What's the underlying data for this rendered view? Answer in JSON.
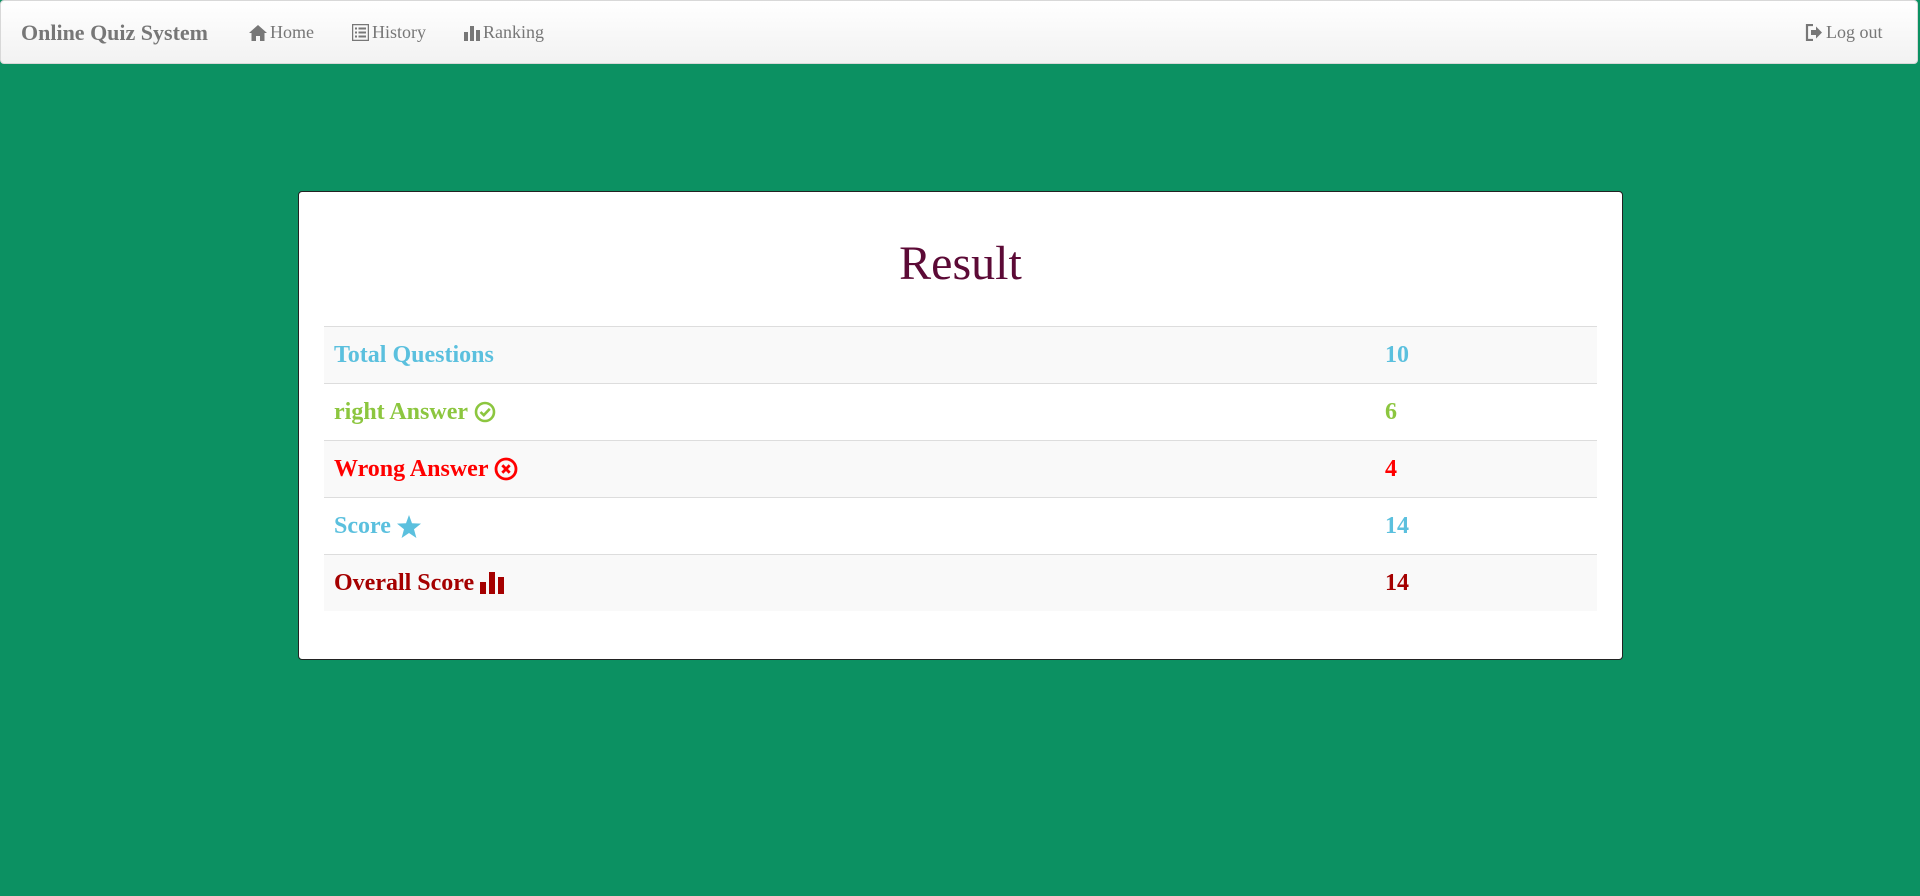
{
  "navbar": {
    "brand": "Online Quiz System",
    "links": [
      {
        "label": "Home",
        "icon": "home-icon"
      },
      {
        "label": "History",
        "icon": "list-icon"
      },
      {
        "label": "Ranking",
        "icon": "bar-chart-icon"
      }
    ],
    "logout": {
      "label": "Log out",
      "icon": "logout-icon"
    }
  },
  "result": {
    "title": "Result",
    "rows": [
      {
        "label": "Total Questions",
        "value": "10",
        "color": "#5bc0de",
        "icon": ""
      },
      {
        "label": "right Answer",
        "value": "6",
        "color": "#8cc63f",
        "icon": "check-circle-icon"
      },
      {
        "label": "Wrong Answer",
        "value": "4",
        "color": "#ff0000",
        "icon": "x-circle-icon"
      },
      {
        "label": "Score",
        "value": "14",
        "color": "#5bc0de",
        "icon": "star-icon"
      },
      {
        "label": "Overall Score",
        "value": "14",
        "color": "#a50000",
        "icon": "bar-chart-icon"
      }
    ]
  },
  "colors": {
    "background": "#0c9162",
    "title": "#5c0a36"
  }
}
